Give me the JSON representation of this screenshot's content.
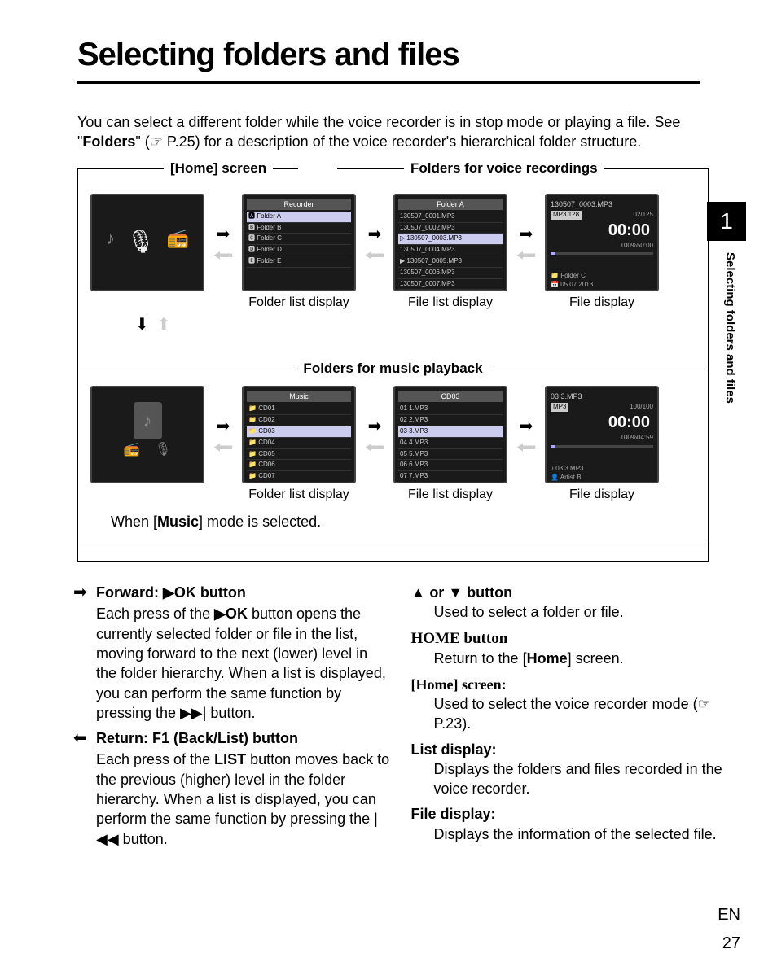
{
  "title": "Selecting folders and files",
  "intro_pre": "You can select a different folder while the voice recorder is in stop mode or playing a file. See \"",
  "intro_bold": "Folders",
  "intro_post": "\" (☞ P.25) for a description of the voice recorder's hierarchical folder structure.",
  "labels": {
    "home_screen": "[Home] screen",
    "folders_voice": "Folders for voice recordings",
    "folders_music": "Folders for music playback"
  },
  "captions": {
    "folder_list": "Folder list display",
    "file_list": "File list display",
    "file_disp": "File display"
  },
  "voice": {
    "folder_title": "Recorder",
    "folders": [
      "Folder A",
      "Folder B",
      "Folder C",
      "Folder D",
      "Folder E"
    ],
    "file_list_title": "Folder A",
    "files": [
      "130507_0001.MP3",
      "130507_0002.MP3",
      "130507_0003.MP3",
      "130507_0004.MP3",
      "130507_0005.MP3",
      "130507_0006.MP3",
      "130507_0007.MP3"
    ],
    "selected_file": "130507_0003.MP3",
    "file_display": {
      "name": "130507_0003.MP3",
      "badge": "MP3 128",
      "counter": "02/125",
      "time": "00:00",
      "total": "50:00",
      "level": "100%",
      "folder": "Folder C",
      "date": "05.07.2013"
    }
  },
  "music": {
    "folder_title": "Music",
    "folders": [
      "CD01",
      "CD02",
      "CD03",
      "CD04",
      "CD05",
      "CD06",
      "CD07"
    ],
    "file_list_title": "CD03",
    "files": [
      "01 1.MP3",
      "02 2.MP3",
      "03 3.MP3",
      "04 4.MP3",
      "05 5.MP3",
      "06 6.MP3",
      "07 7.MP3"
    ],
    "selected_file": "03 3.MP3",
    "file_display": {
      "name": "03 3.MP3",
      "badge": "MP3",
      "counter": "100/100",
      "time": "00:00",
      "total": "04:59",
      "level": "100%",
      "track": "03 3.MP3",
      "artist": "Artist B"
    }
  },
  "music_note_pre": "When [",
  "music_note_bold": "Music",
  "music_note_post": "] mode is selected.",
  "chapter": "1",
  "side_title": "Selecting folders and files",
  "col1": {
    "h1_prefix": "➡",
    "h1": "Forward: ▶OK button",
    "p1a": "Each press of the ",
    "p1b": "▶OK",
    "p1c": " button opens the currently selected folder or file in the list, moving forward to the next (lower) level in the folder hierarchy. When a list is displayed, you can perform the same function by pressing the ▶▶| button.",
    "h2_prefix": "⬅",
    "h2": "Return: F1 (Back/List) button",
    "p2a": "Each press of the ",
    "p2b": "LIST",
    "p2c": " button moves back to the previous (higher) level in the folder hierarchy. When a list is displayed, you can perform the same function by pressing the |◀◀ button."
  },
  "col2": {
    "h1": "▲ or ▼ button",
    "p1": "Used to select a folder or file.",
    "h2": "HOME button",
    "p2a": "Return to the [",
    "p2b": "Home",
    "p2c": "] screen.",
    "h3": "[Home] screen:",
    "p3": "Used to select the voice recorder mode (☞ P.23).",
    "h4": "List display:",
    "p4": "Displays the folders and files recorded in the voice recorder.",
    "h5": "File display:",
    "p5": "Displays the information of the selected file."
  },
  "lang": "EN",
  "page": "27"
}
